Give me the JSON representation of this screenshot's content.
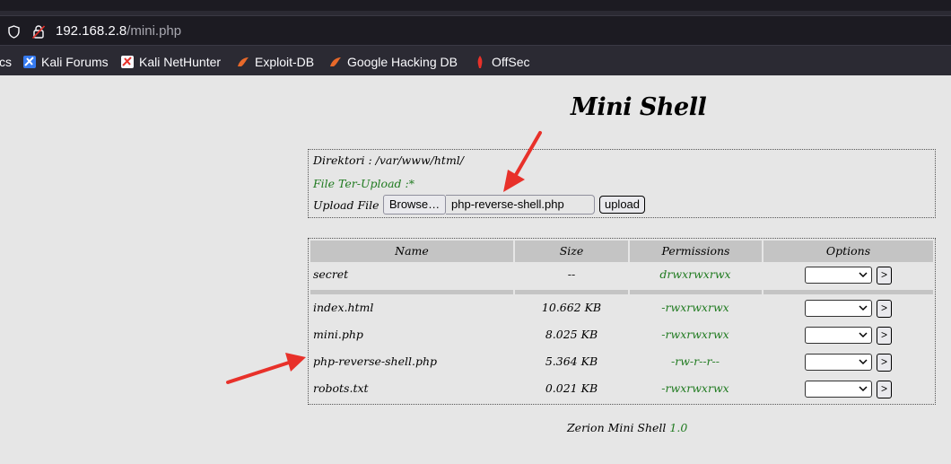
{
  "browser": {
    "url_host": "192.168.2.8",
    "url_path": "/mini.php",
    "bookmarks": [
      {
        "label": "cs",
        "icon": "docs-icon"
      },
      {
        "label": "Kali Forums",
        "icon": "kali-dragon-icon"
      },
      {
        "label": "Kali NetHunter",
        "icon": "kali-dragon-icon"
      },
      {
        "label": "Exploit-DB",
        "icon": "exploit-db-icon"
      },
      {
        "label": "Google Hacking DB",
        "icon": "exploit-db-icon"
      },
      {
        "label": "OffSec",
        "icon": "offsec-icon"
      }
    ]
  },
  "page": {
    "title": "Mini Shell",
    "directory_line": "Direktori : /var/www/html/",
    "uploaded_line": "File Ter-Upload :*",
    "upload_label": "Upload File :",
    "browse_label": "Browse…",
    "chosen_file": "php-reverse-shell.php",
    "upload_button": "upload",
    "table": {
      "headers": [
        "Name",
        "Size",
        "Permissions",
        "Options"
      ],
      "dirs": [
        {
          "name": "secret",
          "size": "--",
          "perm": "drwxrwxrwx"
        }
      ],
      "files": [
        {
          "name": "index.html",
          "size": "10.662 KB",
          "perm": "-rwxrwxrwx"
        },
        {
          "name": "mini.php",
          "size": "8.025 KB",
          "perm": "-rwxrwxrwx"
        },
        {
          "name": "php-reverse-shell.php",
          "size": "5.364 KB",
          "perm": "-rw-r--r--"
        },
        {
          "name": "robots.txt",
          "size": "0.021 KB",
          "perm": "-rwxrwxrwx"
        }
      ],
      "go_label": ">"
    },
    "footer_text": "Zerion Mini Shell",
    "footer_version": "1.0"
  },
  "colors": {
    "green": "#1f7a1f",
    "annotation_arrow": "#e8312a",
    "page_bg": "#e6e6e6",
    "header_bg": "#c4c4c4"
  }
}
